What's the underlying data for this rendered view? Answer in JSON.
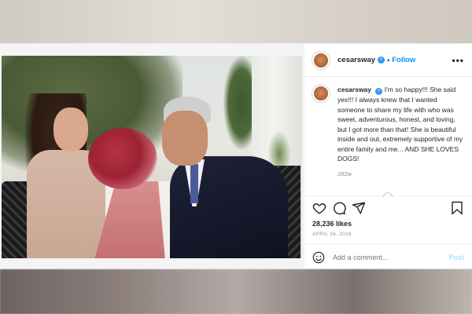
{
  "post": {
    "username": "cesarsway",
    "follow_label": "Follow",
    "more_label": "•••",
    "caption": "I'm so happy!!! She said yes!!! I always knew that I wanted someone to share my life with who was sweet, adventurous, honest, and loving, but I got more than that! She is beautiful inside and out, extremely supportive of my entire family and me... AND SHE LOVES DOGS!",
    "time_ago": "282w",
    "likes": "28,236 likes",
    "date": "APRIL 26, 2018"
  },
  "comment": {
    "placeholder": "Add a comment...",
    "post_label": "Post"
  },
  "icons": {
    "verified": "verified-badge-icon",
    "like": "heart-icon",
    "comment": "comment-icon",
    "share": "share-icon",
    "save": "bookmark-icon",
    "emoji": "emoji-icon",
    "more": "more-icon"
  },
  "colors": {
    "link": "#0095f6",
    "verified": "#3897f0",
    "text": "#262626",
    "muted": "#8e8e8e",
    "post_disabled": "#b2dffc"
  }
}
